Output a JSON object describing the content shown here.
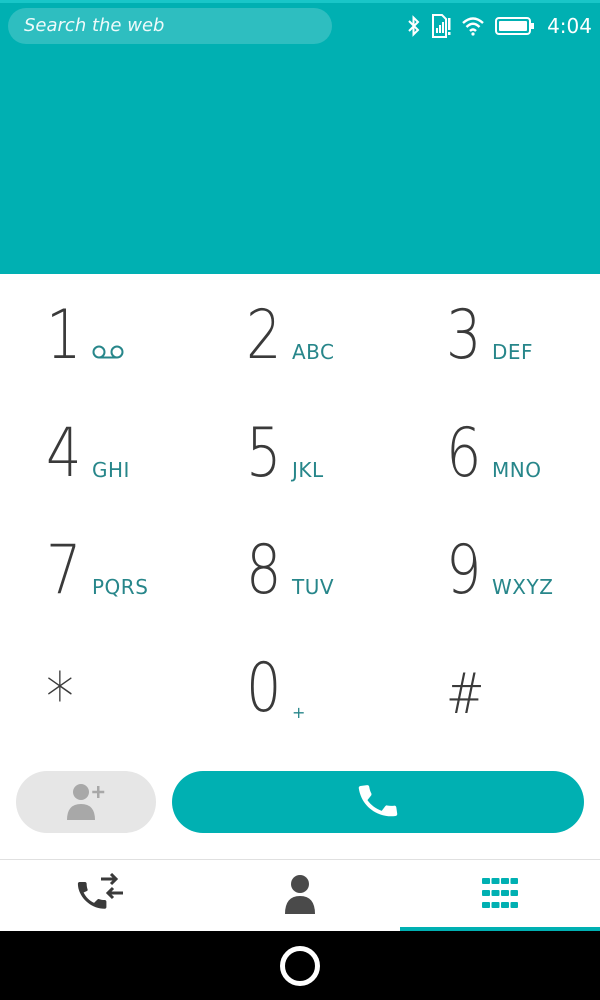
{
  "status_bar": {
    "search_placeholder": "Search the web",
    "time": "4:04",
    "icons": [
      "bluetooth-icon",
      "sim-signal-icon",
      "wifi-icon",
      "battery-icon"
    ]
  },
  "keypad": {
    "keys": [
      {
        "digit": "1",
        "letters": "",
        "icon": "voicemail-icon"
      },
      {
        "digit": "2",
        "letters": "ABC"
      },
      {
        "digit": "3",
        "letters": "DEF"
      },
      {
        "digit": "4",
        "letters": "GHI"
      },
      {
        "digit": "5",
        "letters": "JKL"
      },
      {
        "digit": "6",
        "letters": "MNO"
      },
      {
        "digit": "7",
        "letters": "PQRS"
      },
      {
        "digit": "8",
        "letters": "TUV"
      },
      {
        "digit": "9",
        "letters": "WXYZ"
      },
      {
        "digit": "*",
        "letters": ""
      },
      {
        "digit": "0",
        "letters": "+"
      },
      {
        "digit": "#",
        "letters": ""
      }
    ]
  },
  "actions": {
    "add_contact_icon": "add-contact-icon",
    "call_icon": "phone-icon"
  },
  "tabs": [
    {
      "name": "call-log",
      "icon": "call-log-icon",
      "active": false
    },
    {
      "name": "contacts",
      "icon": "contact-icon",
      "active": false
    },
    {
      "name": "keypad",
      "icon": "keypad-icon",
      "active": true
    }
  ],
  "colors": {
    "accent": "#00b0b2",
    "digit": "#3a3a3a",
    "letters": "#27868a",
    "nav": "#000000"
  }
}
